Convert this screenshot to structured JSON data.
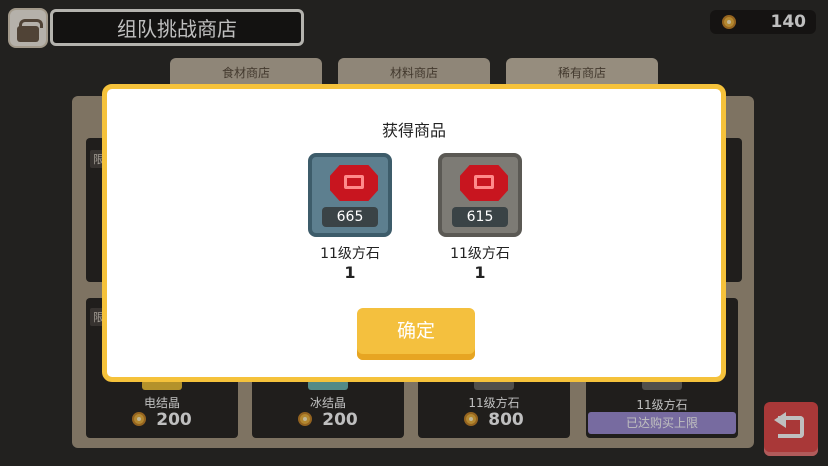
{
  "header": {
    "title": "组队挑战商店",
    "icon": "shop-icon"
  },
  "currency": {
    "icon": "coin-icon",
    "value": "140"
  },
  "tabs": [
    {
      "label": "食材商店"
    },
    {
      "label": "材料商店"
    },
    {
      "label": "稀有商店"
    }
  ],
  "limit_tag": "限",
  "cards": [
    {
      "name": "电结晶",
      "price": "200"
    },
    {
      "name": "冰结晶",
      "price": "200"
    },
    {
      "name": "11级方石",
      "price": "800"
    },
    {
      "name": "11级方石",
      "status": "已达购买上限"
    }
  ],
  "modal": {
    "title": "获得商品",
    "items": [
      {
        "count": "665",
        "name": "11级方石",
        "qty": "1",
        "frame": "#5d7f8f"
      },
      {
        "count": "615",
        "name": "11级方石",
        "qty": "1",
        "frame": "#7d7b75"
      }
    ],
    "confirm_label": "确定"
  },
  "colors": {
    "accent": "#f5c23b",
    "back_button": "#e24b4b",
    "maxed": "#9f8fd6"
  }
}
